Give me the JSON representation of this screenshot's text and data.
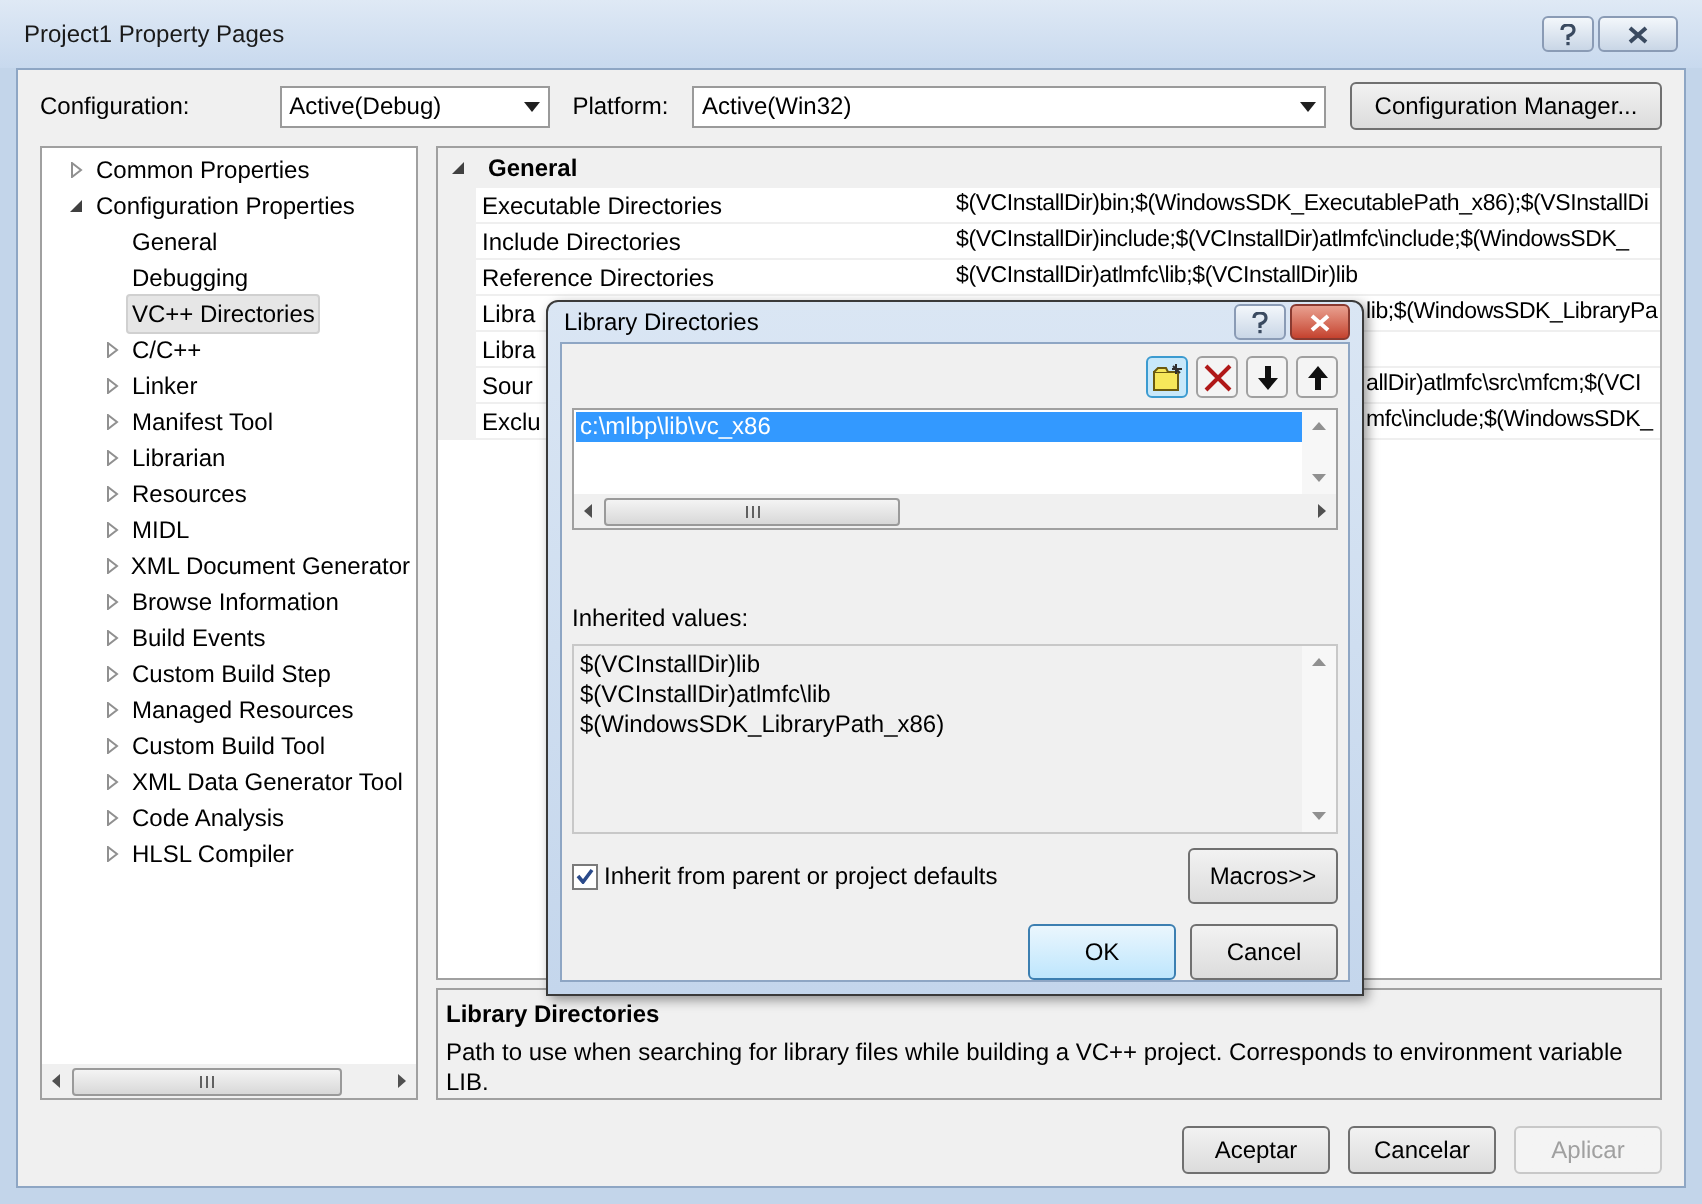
{
  "window": {
    "title": "Project1 Property Pages"
  },
  "configuration": {
    "label": "Configuration:",
    "value": "Active(Debug)"
  },
  "platform": {
    "label": "Platform:",
    "value": "Active(Win32)"
  },
  "config_manager_button": "Configuration Manager...",
  "tree": [
    {
      "label": "Common Properties",
      "expanded": false,
      "selected": false
    },
    {
      "label": "Configuration Properties",
      "expanded": true,
      "selected": false,
      "children": [
        {
          "label": "General",
          "selected": false
        },
        {
          "label": "Debugging",
          "selected": false
        },
        {
          "label": "VC++ Directories",
          "selected": true
        },
        {
          "label": "C/C++",
          "expanded": false,
          "selected": false
        },
        {
          "label": "Linker",
          "expanded": false,
          "selected": false
        },
        {
          "label": "Manifest Tool",
          "expanded": false,
          "selected": false
        },
        {
          "label": "Librarian",
          "expanded": false,
          "selected": false
        },
        {
          "label": "Resources",
          "expanded": false,
          "selected": false
        },
        {
          "label": "MIDL",
          "expanded": false,
          "selected": false
        },
        {
          "label": "XML Document Generator",
          "expanded": false,
          "selected": false
        },
        {
          "label": "Browse Information",
          "expanded": false,
          "selected": false
        },
        {
          "label": "Build Events",
          "expanded": false,
          "selected": false
        },
        {
          "label": "Custom Build Step",
          "expanded": false,
          "selected": false
        },
        {
          "label": "Managed Resources",
          "expanded": false,
          "selected": false
        },
        {
          "label": "Custom Build Tool",
          "expanded": false,
          "selected": false
        },
        {
          "label": "XML Data Generator Tool",
          "expanded": false,
          "selected": false
        },
        {
          "label": "Code Analysis",
          "expanded": false,
          "selected": false
        },
        {
          "label": "HLSL Compiler",
          "expanded": false,
          "selected": false
        }
      ]
    }
  ],
  "property_grid": {
    "category": {
      "label": "General",
      "expanded": true
    },
    "rows": [
      {
        "kind": "full",
        "name": "Executable Directories",
        "value": "$(VCInstallDir)bin;$(WindowsSDK_ExecutablePath_x86);$(VSInstallDi"
      },
      {
        "kind": "full",
        "name": "Include Directories",
        "value": "$(VCInstallDir)include;$(VCInstallDir)atlmfc\\include;$(WindowsSDK_"
      },
      {
        "kind": "full",
        "name": "Reference Directories",
        "value": "$(VCInstallDir)atlmfc\\lib;$(VCInstallDir)lib"
      },
      {
        "kind": "clipped",
        "name": "Libra",
        "value": "lib;$(WindowsSDK_LibraryPa"
      },
      {
        "kind": "clipped",
        "name": "Libra"
      },
      {
        "kind": "clipped",
        "name": "Sour",
        "value": "allDir)atlmfc\\src\\mfcm;$(VCI"
      },
      {
        "kind": "clipped",
        "name": "Exclu",
        "value": "mfc\\include;$(WindowsSDK_"
      }
    ]
  },
  "description": {
    "title": "Library Directories",
    "text": "Path to use when searching for library files while building a VC++ project.  Corresponds to environment variable LIB."
  },
  "buttons": [
    {
      "label": "Aceptar",
      "disabled": false
    },
    {
      "label": "Cancelar",
      "disabled": false
    },
    {
      "label": "Aplicar",
      "disabled": true
    }
  ],
  "dialog": {
    "title": "Library Directories",
    "entries": [
      {
        "text": "c:\\mlbp\\lib\\vc_x86",
        "selected": true
      }
    ],
    "inherited_label": "Inherited values:",
    "inherited_values": [
      "$(VCInstallDir)lib",
      "$(VCInstallDir)atlmfc\\lib",
      "$(WindowsSDK_LibraryPath_x86)"
    ],
    "inherit_checkbox": {
      "label": "Inherit from parent or project defaults",
      "checked": true
    },
    "macros_button": "Macros>>",
    "buttons": [
      {
        "label": "OK",
        "default": true
      },
      {
        "label": "Cancel",
        "default": false
      }
    ]
  }
}
